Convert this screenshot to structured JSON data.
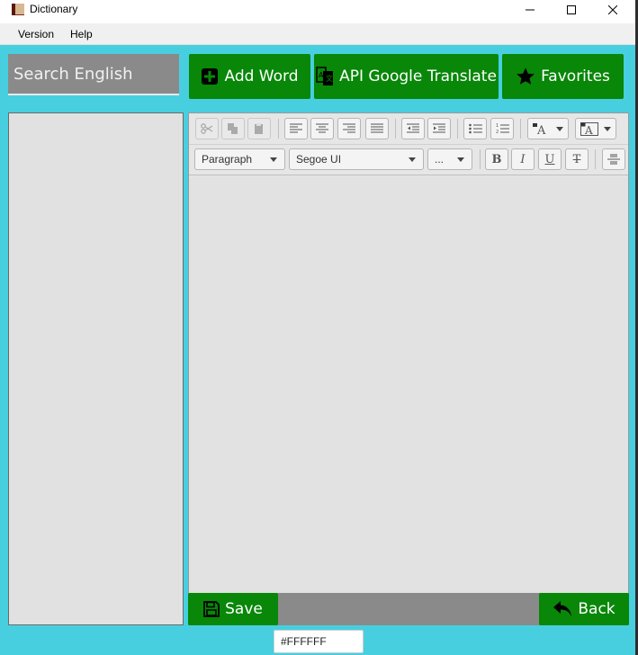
{
  "window": {
    "title": "Dictionary",
    "controls": {
      "minimize": "—",
      "maximize": "☐",
      "close": "✕"
    }
  },
  "menu": {
    "items": [
      "Version",
      "Help"
    ]
  },
  "search": {
    "placeholder": "Search English",
    "value": ""
  },
  "top_buttons": {
    "add_word": "Add Word",
    "api_translate": "API Google Translate",
    "favorites": "Favorites"
  },
  "editor": {
    "paragraph_style": "Paragraph",
    "font_family": "Segoe UI",
    "font_size": "...",
    "format_labels": {
      "bold": "B",
      "italic": "I",
      "underline": "U",
      "strike": "T"
    }
  },
  "bottom_buttons": {
    "save": "Save",
    "back": "Back"
  },
  "color_value": "#FFFFFF",
  "colors": {
    "background": "#47cfe0",
    "button_green": "#088708",
    "search_gray": "#8a8a8a",
    "list_gray": "#e1e1e1"
  }
}
